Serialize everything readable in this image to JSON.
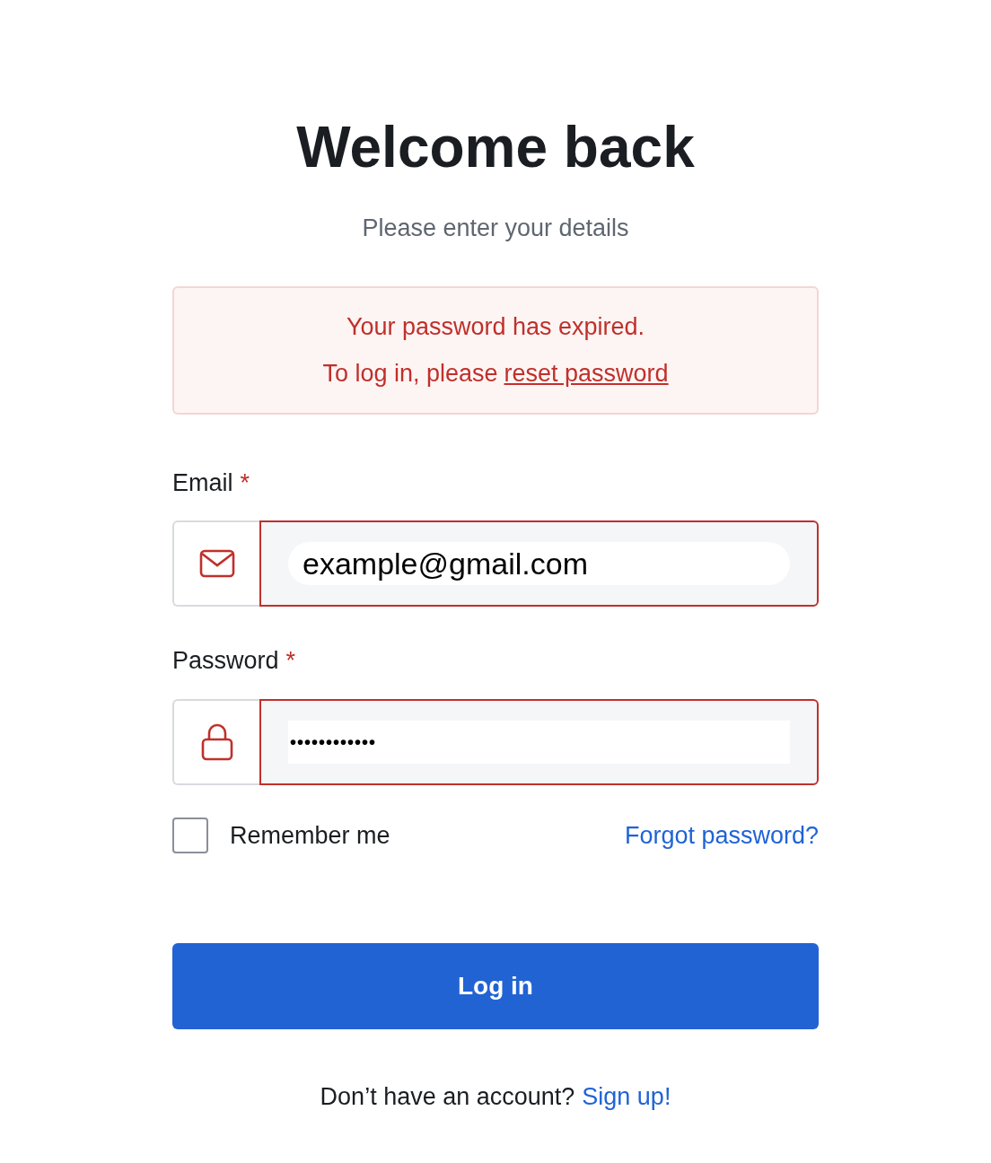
{
  "heading": "Welcome back",
  "subheading": "Please enter your details",
  "alert": {
    "line_1": "Your password has expired.",
    "line_2_prefix": "To log in, please",
    "link": "reset password"
  },
  "fields": [
    {
      "kind": "email",
      "label": "Email",
      "required_mark": "*",
      "value": "example@gmail.com",
      "invalid": true
    },
    {
      "kind": "password",
      "label": "Password",
      "required_mark": "*",
      "value": "••••••••••••",
      "invalid": true
    }
  ],
  "remember": {
    "label": "Remember me",
    "checked": false
  },
  "forgot_link": "Forgot password?",
  "submit_button": "Log in",
  "footer": {
    "text": "Don’t have an account?",
    "link": "Sign up!"
  }
}
